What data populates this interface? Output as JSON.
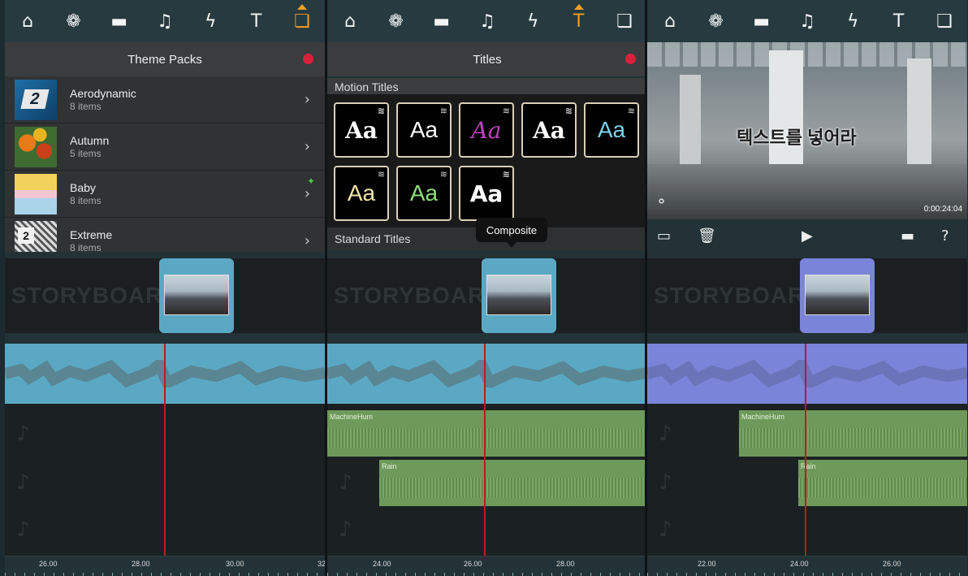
{
  "toolbar": {
    "icons": [
      "home-icon",
      "theme-icon",
      "folder-icon",
      "music-icon",
      "effects-icon",
      "titles-icon",
      "composite-icon"
    ],
    "glyphs": [
      "⌂",
      "❁",
      "▬",
      "♫",
      "ϟ",
      "T",
      "❏"
    ]
  },
  "accent_color": "#f0a020",
  "record_color": "#d8203a",
  "theme_packs": {
    "title": "Theme Packs",
    "items": [
      {
        "title": "Aerodynamic",
        "subtitle": "8 items",
        "thumb_text": "2"
      },
      {
        "title": "Autumn",
        "subtitle": "5 items"
      },
      {
        "title": "Baby",
        "subtitle": "8 items"
      },
      {
        "title": "Extreme",
        "subtitle": "8 items",
        "thumb_text": "2"
      }
    ]
  },
  "titles": {
    "title": "Titles",
    "motion_label": "Motion Titles",
    "standard_label": "Standard Titles",
    "tile_text": "Aa",
    "tooltip": "Composite"
  },
  "preview": {
    "overlay_text": "텍스트를 넣어라",
    "timecode": "0:00:24:04"
  },
  "storyboard": {
    "label": "STORYBOARD"
  },
  "clips": {
    "machine": "MachineHum",
    "rain": "Rain"
  },
  "rulers": [
    [
      "26.00",
      "28.00",
      "30.00",
      "32"
    ],
    [
      "24.00",
      "26.00",
      "28.00"
    ],
    [
      "22.00",
      "24.00",
      "26.00"
    ]
  ]
}
